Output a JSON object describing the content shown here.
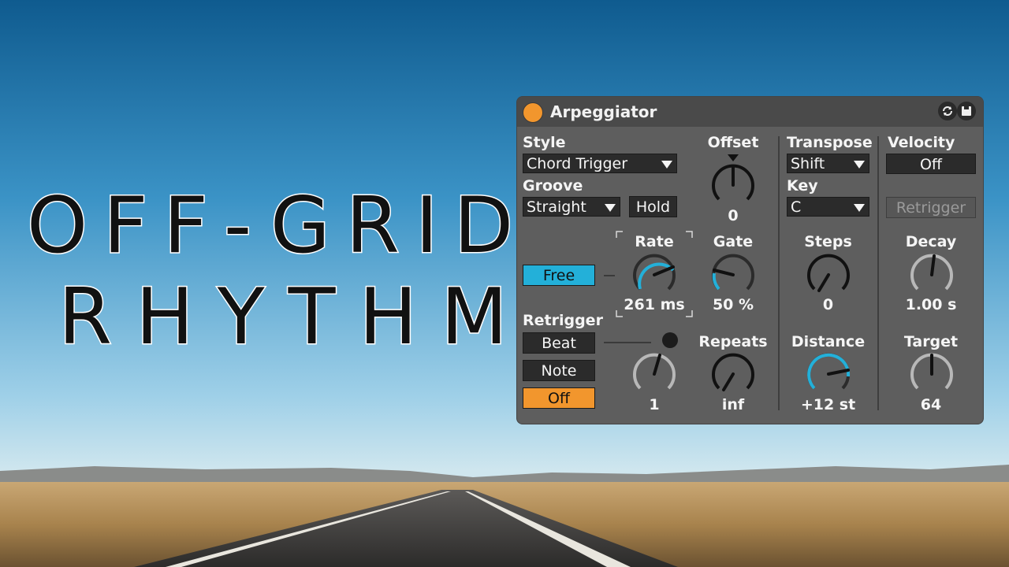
{
  "title": {
    "line1": "OFF-GRID",
    "line2": "RHYTHM"
  },
  "device": {
    "name": "Arpeggiator",
    "colors": {
      "accent_blue": "#23b0d9",
      "accent_orange": "#f2962d"
    },
    "icons": {
      "power": "power-toggle",
      "hot_swap": "hot-swap-icon",
      "save": "save-preset-icon"
    },
    "style": {
      "label": "Style",
      "value": "Chord Trigger"
    },
    "groove": {
      "label": "Groove",
      "value": "Straight"
    },
    "hold": {
      "label": "Hold"
    },
    "offset": {
      "label": "Offset",
      "value": "0"
    },
    "transpose": {
      "label": "Transpose",
      "value": "Shift"
    },
    "key": {
      "label": "Key",
      "value": "C"
    },
    "velocity": {
      "label": "Velocity",
      "value": "Off"
    },
    "retrigger_vel": {
      "label": "Retrigger"
    },
    "rate": {
      "label": "Rate",
      "value": "261 ms",
      "sync_mode": "Free"
    },
    "gate": {
      "label": "Gate",
      "value": "50 %"
    },
    "steps": {
      "label": "Steps",
      "value": "0"
    },
    "decay": {
      "label": "Decay",
      "value": "1.00 s"
    },
    "retrigger": {
      "label": "Retrigger",
      "options": [
        "Beat",
        "Note",
        "Off"
      ],
      "selected": "Off",
      "knob_value": "1"
    },
    "repeats": {
      "label": "Repeats",
      "value": "inf"
    },
    "distance": {
      "label": "Distance",
      "value": "+12 st"
    },
    "target": {
      "label": "Target",
      "value": "64"
    }
  }
}
